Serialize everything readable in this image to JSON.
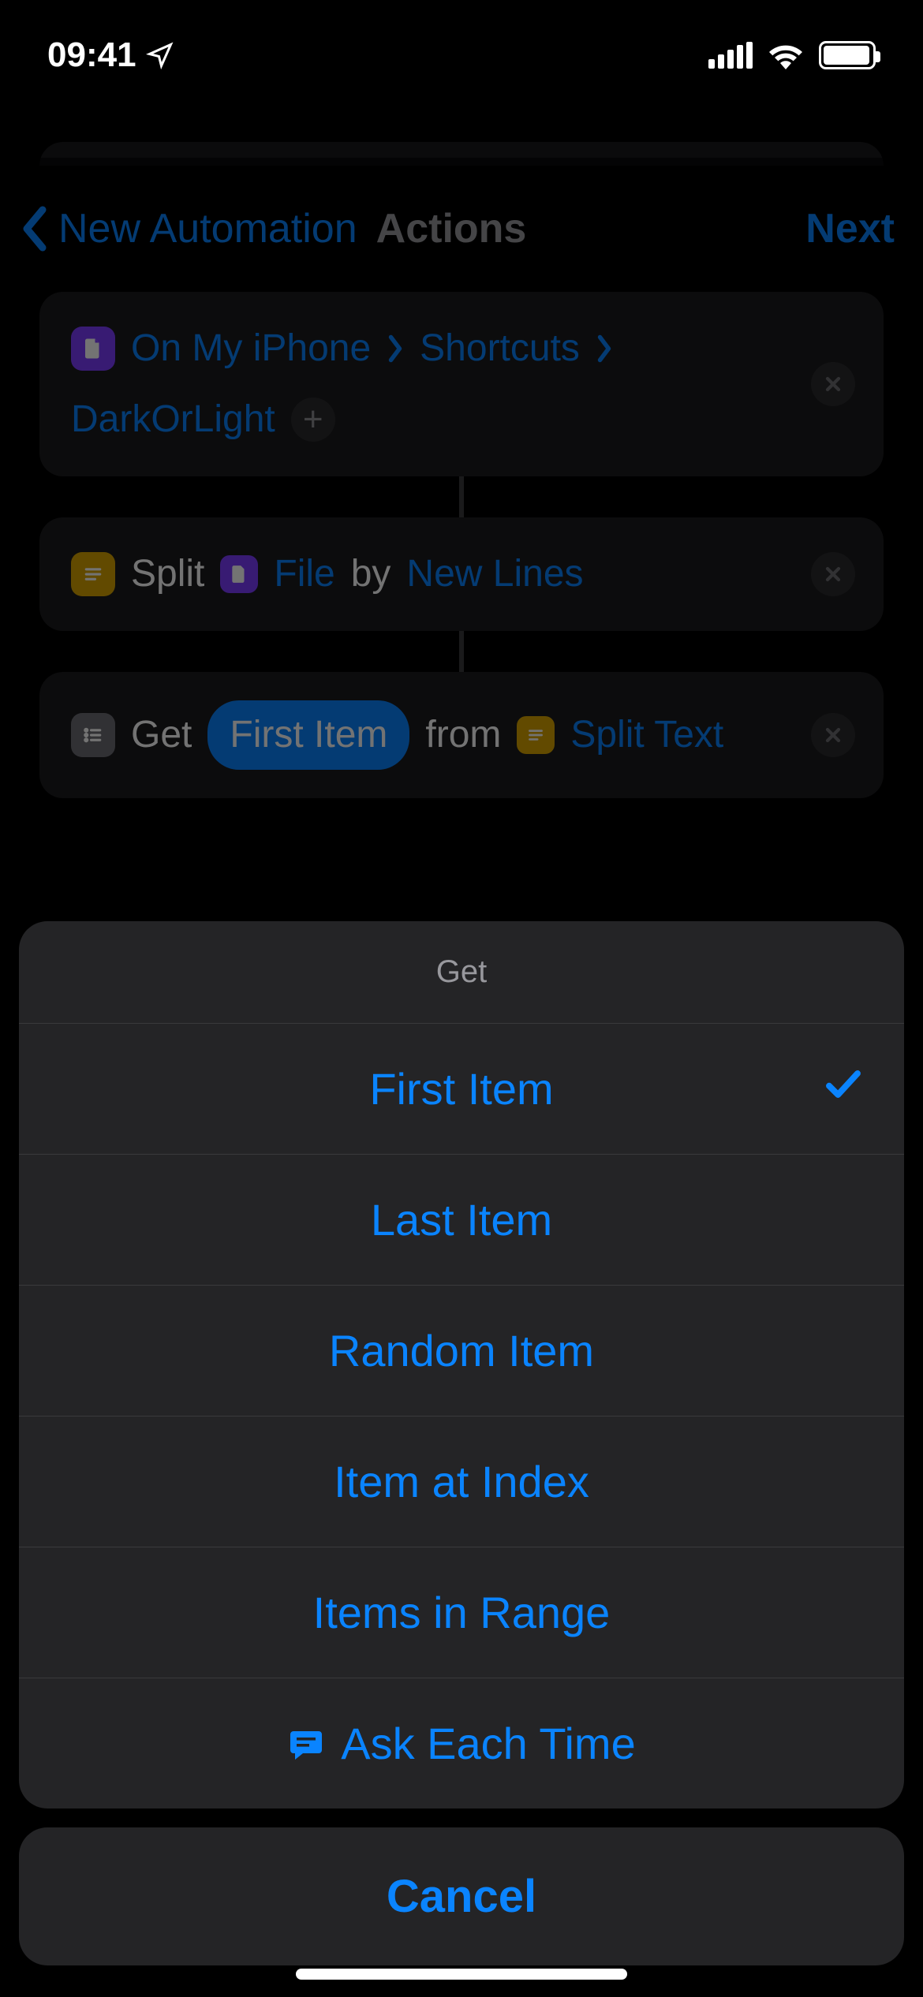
{
  "status": {
    "time": "09:41"
  },
  "nav": {
    "back": "New Automation",
    "title": "Actions",
    "next": "Next"
  },
  "actions": {
    "a1": {
      "seg1": "On My iPhone",
      "seg2": "Shortcuts",
      "seg3": "DarkOrLight"
    },
    "a2": {
      "verb": "Split",
      "param": "File",
      "by": "by",
      "mode": "New Lines"
    },
    "a3": {
      "verb": "Get",
      "selection": "First Item",
      "from": "from",
      "input": "Split Text"
    }
  },
  "picker": {
    "title": "Get",
    "options": [
      "First Item",
      "Last Item",
      "Random Item",
      "Item at Index",
      "Items in Range"
    ],
    "ask": "Ask Each Time",
    "cancel": "Cancel",
    "selected_index": 0
  }
}
